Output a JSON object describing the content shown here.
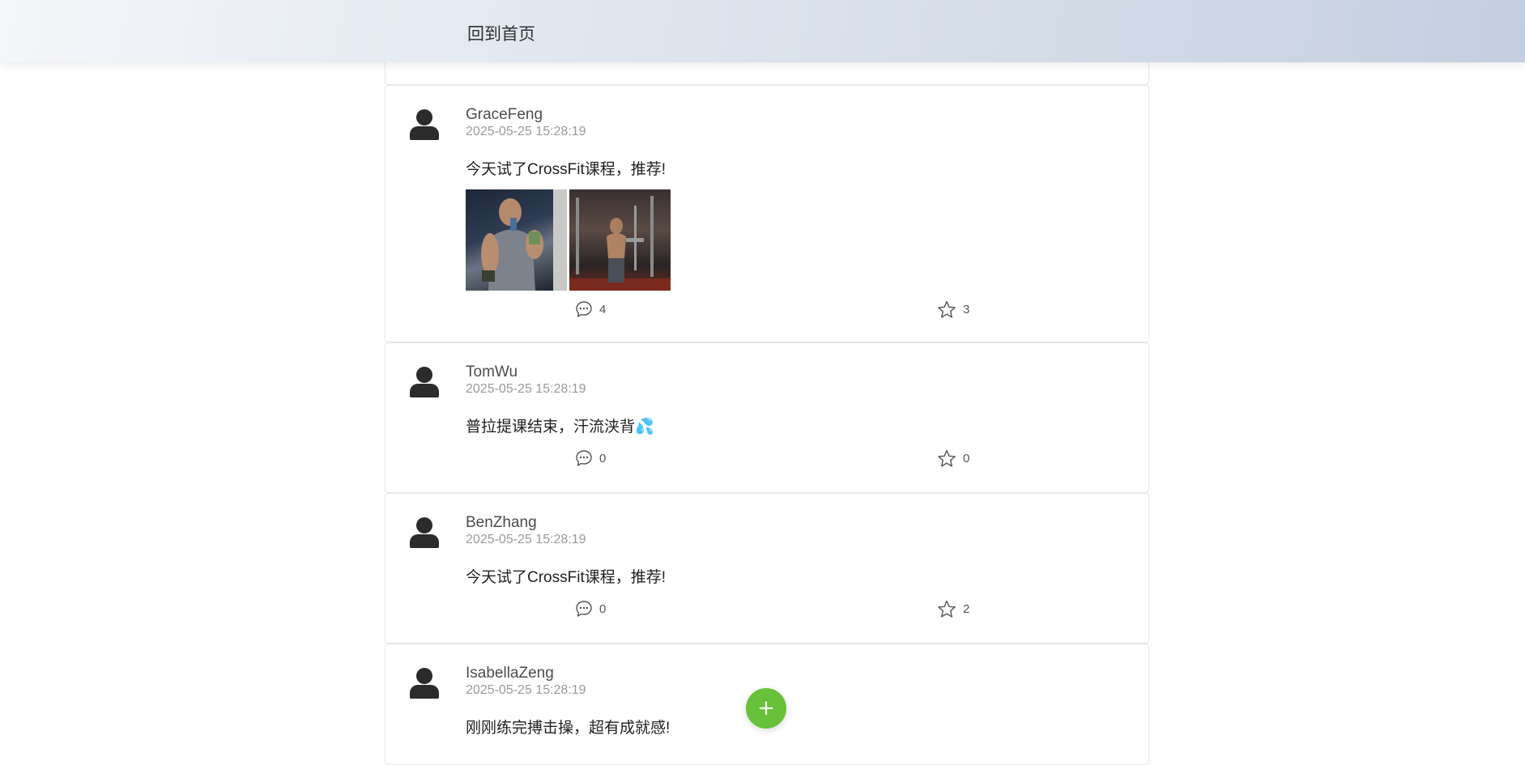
{
  "header": {
    "home_label": "回到首页"
  },
  "posts": [
    {
      "username": "GraceFeng",
      "time": "2025-05-25 15:28:19",
      "content": "今天试了CrossFit课程，推荐!",
      "comment_count": "4",
      "like_count": "3"
    },
    {
      "username": "TomWu",
      "time": "2025-05-25 15:28:19",
      "content": "普拉提课结束，汗流浃背💦",
      "comment_count": "0",
      "like_count": "0"
    },
    {
      "username": "BenZhang",
      "time": "2025-05-25 15:28:19",
      "content": "今天试了CrossFit课程，推荐!",
      "comment_count": "0",
      "like_count": "2"
    },
    {
      "username": "IsabellaZeng",
      "time": "2025-05-25 15:28:19",
      "content": "刚刚练完搏击操，超有成就感!"
    }
  ],
  "icons": {
    "avatar": "user-avatar-icon",
    "comment": "comment-icon",
    "like": "star-icon",
    "add": "plus-icon"
  },
  "fab": {
    "label": "+"
  },
  "colors": {
    "accent": "#67c23a",
    "header_gradient_end": "#c3cfe0"
  }
}
